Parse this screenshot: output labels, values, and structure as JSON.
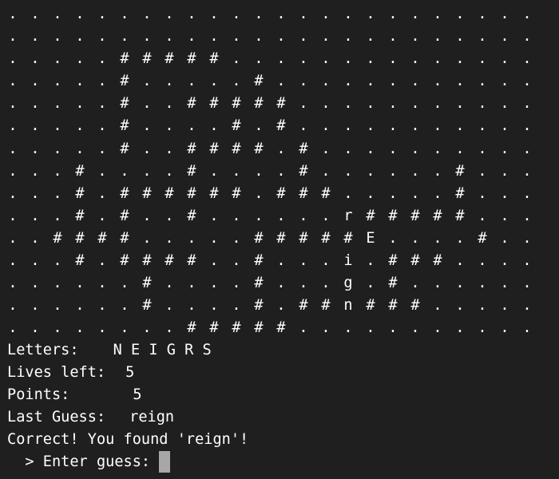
{
  "board": [
    "........................",
    "........................",
    ".....#####..............",
    ".....#.....#............",
    ".....#..#####...........",
    ".....#....#.#...........",
    ".....#..####.#..........",
    "...#....#....#......#...",
    "...#.######.###.....#...",
    "...#.#..#......r#####...",
    "..####.....#####E....#..",
    "...#.####..#...i.###....",
    "......#....#...g.#......",
    "......#....#.##n###.....",
    "........#####..........."
  ],
  "status": {
    "letters_label": "Letters:",
    "letters_value": "N E I G R S",
    "lives_label": "Lives left:",
    "lives_value": "5",
    "points_label": "Points:",
    "points_value": "5",
    "last_guess_label": "Last Guess:",
    "last_guess_value": "reign",
    "message": "Correct! You found 'reign'!"
  },
  "prompt": {
    "text": "  > Enter guess: "
  }
}
